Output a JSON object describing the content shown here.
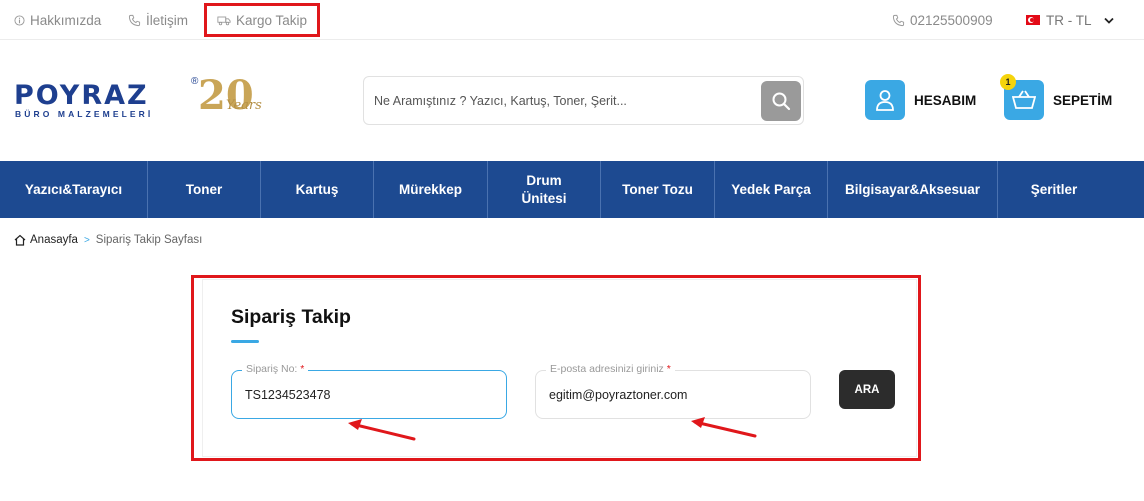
{
  "topbar": {
    "about": "Hakkımızda",
    "contact": "İletişim",
    "cargo": "Kargo Takip",
    "phone": "02125500909",
    "language": "TR - TL"
  },
  "logo": {
    "name": "POYRAZ",
    "tagline": "BÜRO MALZEMELERİ",
    "anniversary": "20",
    "years": "Years"
  },
  "search": {
    "placeholder": "Ne Aramıştınız ? Yazıcı, Kartuş, Toner, Şerit..."
  },
  "account": {
    "label": "HESABIM"
  },
  "cart": {
    "label": "SEPETİM",
    "count": "1"
  },
  "nav": {
    "items": [
      {
        "label": "Yazıcı&Tarayıcı"
      },
      {
        "label": "Toner"
      },
      {
        "label": "Kartuş"
      },
      {
        "label": "Mürekkep"
      },
      {
        "label": "Drum Ünitesi"
      },
      {
        "label": "Toner Tozu"
      },
      {
        "label": "Yedek Parça"
      },
      {
        "label": "Bilgisayar&Aksesuar"
      },
      {
        "label": "Şeritler"
      }
    ]
  },
  "breadcrumb": {
    "home": "Anasayfa",
    "current": "Sipariş Takip Sayfası"
  },
  "tracking": {
    "title": "Sipariş Takip",
    "order_label": "Sipariş No:",
    "order_value": "TS1234523478",
    "email_label": "E-posta adresinizi giriniz",
    "email_value": "egitim@poyraztoner.com",
    "submit_label": "ARA",
    "required_mark": "*"
  },
  "colors": {
    "brand_blue": "#1d4a91",
    "accent_blue": "#3aa8e4",
    "highlight_red": "#e0171b",
    "badge_yellow": "#f5d40c"
  }
}
